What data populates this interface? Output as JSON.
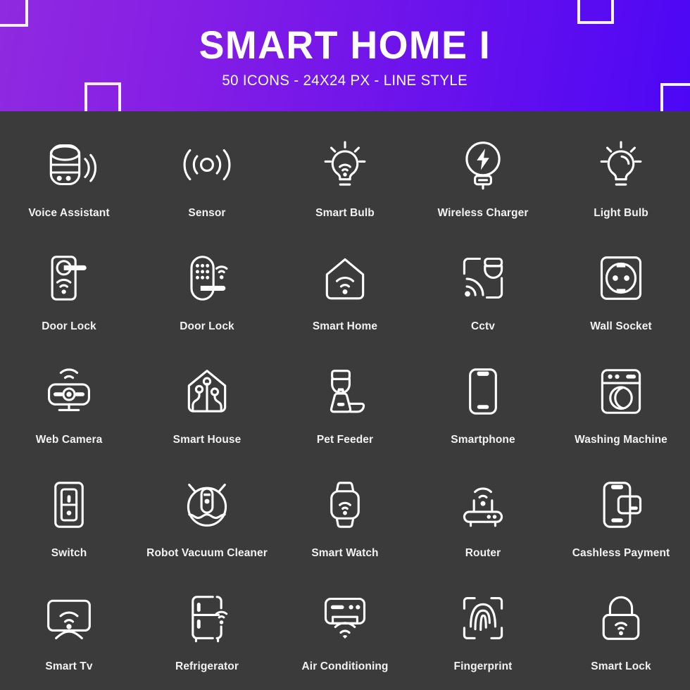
{
  "header": {
    "title": "SMART HOME I",
    "subtitle": "50 ICONS - 24X24 PX - LINE STYLE",
    "gradient_from": "#8f2ae0",
    "gradient_to": "#4c07f5",
    "decor_square_color": "#f4eef8"
  },
  "theme": {
    "background": "#3b3b3b",
    "icon_color": "#ffffff",
    "label_color": "#f2f2f2"
  },
  "grid": {
    "columns": 5,
    "rows": 5,
    "items": [
      {
        "icon": "voice-assistant-icon",
        "label": "Voice Assistant"
      },
      {
        "icon": "sensor-icon",
        "label": "Sensor"
      },
      {
        "icon": "smart-bulb-icon",
        "label": "Smart Bulb"
      },
      {
        "icon": "wireless-charger-icon",
        "label": "Wireless Charger"
      },
      {
        "icon": "light-bulb-icon",
        "label": "Light Bulb"
      },
      {
        "icon": "door-lock-handle-icon",
        "label": "Door Lock"
      },
      {
        "icon": "door-lock-keypad-icon",
        "label": "Door Lock"
      },
      {
        "icon": "smart-home-icon",
        "label": "Smart Home"
      },
      {
        "icon": "cctv-icon",
        "label": "Cctv"
      },
      {
        "icon": "wall-socket-icon",
        "label": "Wall Socket"
      },
      {
        "icon": "web-camera-icon",
        "label": "Web Camera"
      },
      {
        "icon": "smart-house-icon",
        "label": "Smart House"
      },
      {
        "icon": "pet-feeder-icon",
        "label": "Pet Feeder"
      },
      {
        "icon": "smartphone-icon",
        "label": "Smartphone"
      },
      {
        "icon": "washing-machine-icon",
        "label": "Washing Machine"
      },
      {
        "icon": "switch-icon",
        "label": "Switch"
      },
      {
        "icon": "robot-vacuum-cleaner-icon",
        "label": "Robot Vacuum Cleaner"
      },
      {
        "icon": "smart-watch-icon",
        "label": "Smart Watch"
      },
      {
        "icon": "router-icon",
        "label": "Router"
      },
      {
        "icon": "cashless-payment-icon",
        "label": "Cashless Payment"
      },
      {
        "icon": "smart-tv-icon",
        "label": "Smart Tv"
      },
      {
        "icon": "refrigerator-icon",
        "label": "Refrigerator"
      },
      {
        "icon": "air-conditioning-icon",
        "label": "Air Conditioning"
      },
      {
        "icon": "fingerprint-icon",
        "label": "Fingerprint"
      },
      {
        "icon": "smart-lock-icon",
        "label": "Smart Lock"
      }
    ]
  }
}
